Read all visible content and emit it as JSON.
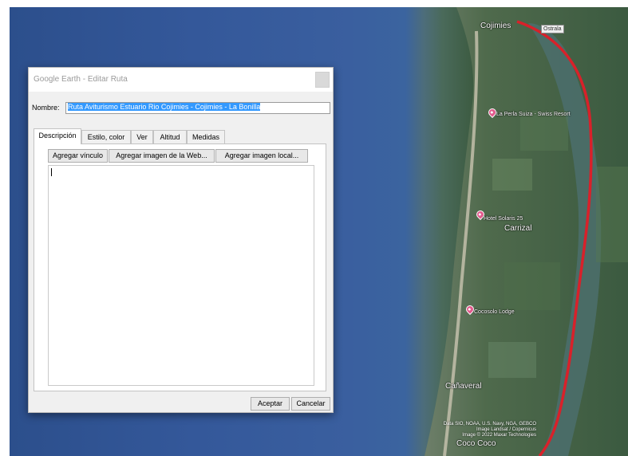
{
  "dialog": {
    "title": "Google Earth - Editar Ruta",
    "name_label": "Nombre:",
    "name_value": "Ruta Aviturismo Estuario Rio Cojimies - Cojimies - La Bonilla",
    "tabs": [
      "Descripción",
      "Estilo, color",
      "Ver",
      "Altitud",
      "Medidas"
    ],
    "active_tab": "Descripción",
    "toolbar": {
      "add_link": "Agregar vínculo",
      "add_web_image": "Agregar imagen de la Web...",
      "add_local_image": "Agregar imagen local..."
    },
    "description_text": "",
    "ok_label": "Aceptar",
    "cancel_label": "Cancelar"
  },
  "map": {
    "places": {
      "cojimies": "Cojimies",
      "la_perla": "La Perla Suiza - Swiss Resort",
      "hotel_solaris": "Hotel Solaris 25",
      "carrizal": "Carrizal",
      "cocosolo": "Cocosolo Lodge",
      "canaveral": "Cañaveral",
      "coco": "Coco Coco"
    },
    "logo_top": "Ostrala",
    "attribution_lines": [
      "Data SIO, NOAA, U.S. Navy, NGA, GEBCO",
      "Image Landsat / Copernicus",
      "Image © 2022 Maxar Technologies"
    ],
    "route_color": "#d8212a"
  }
}
